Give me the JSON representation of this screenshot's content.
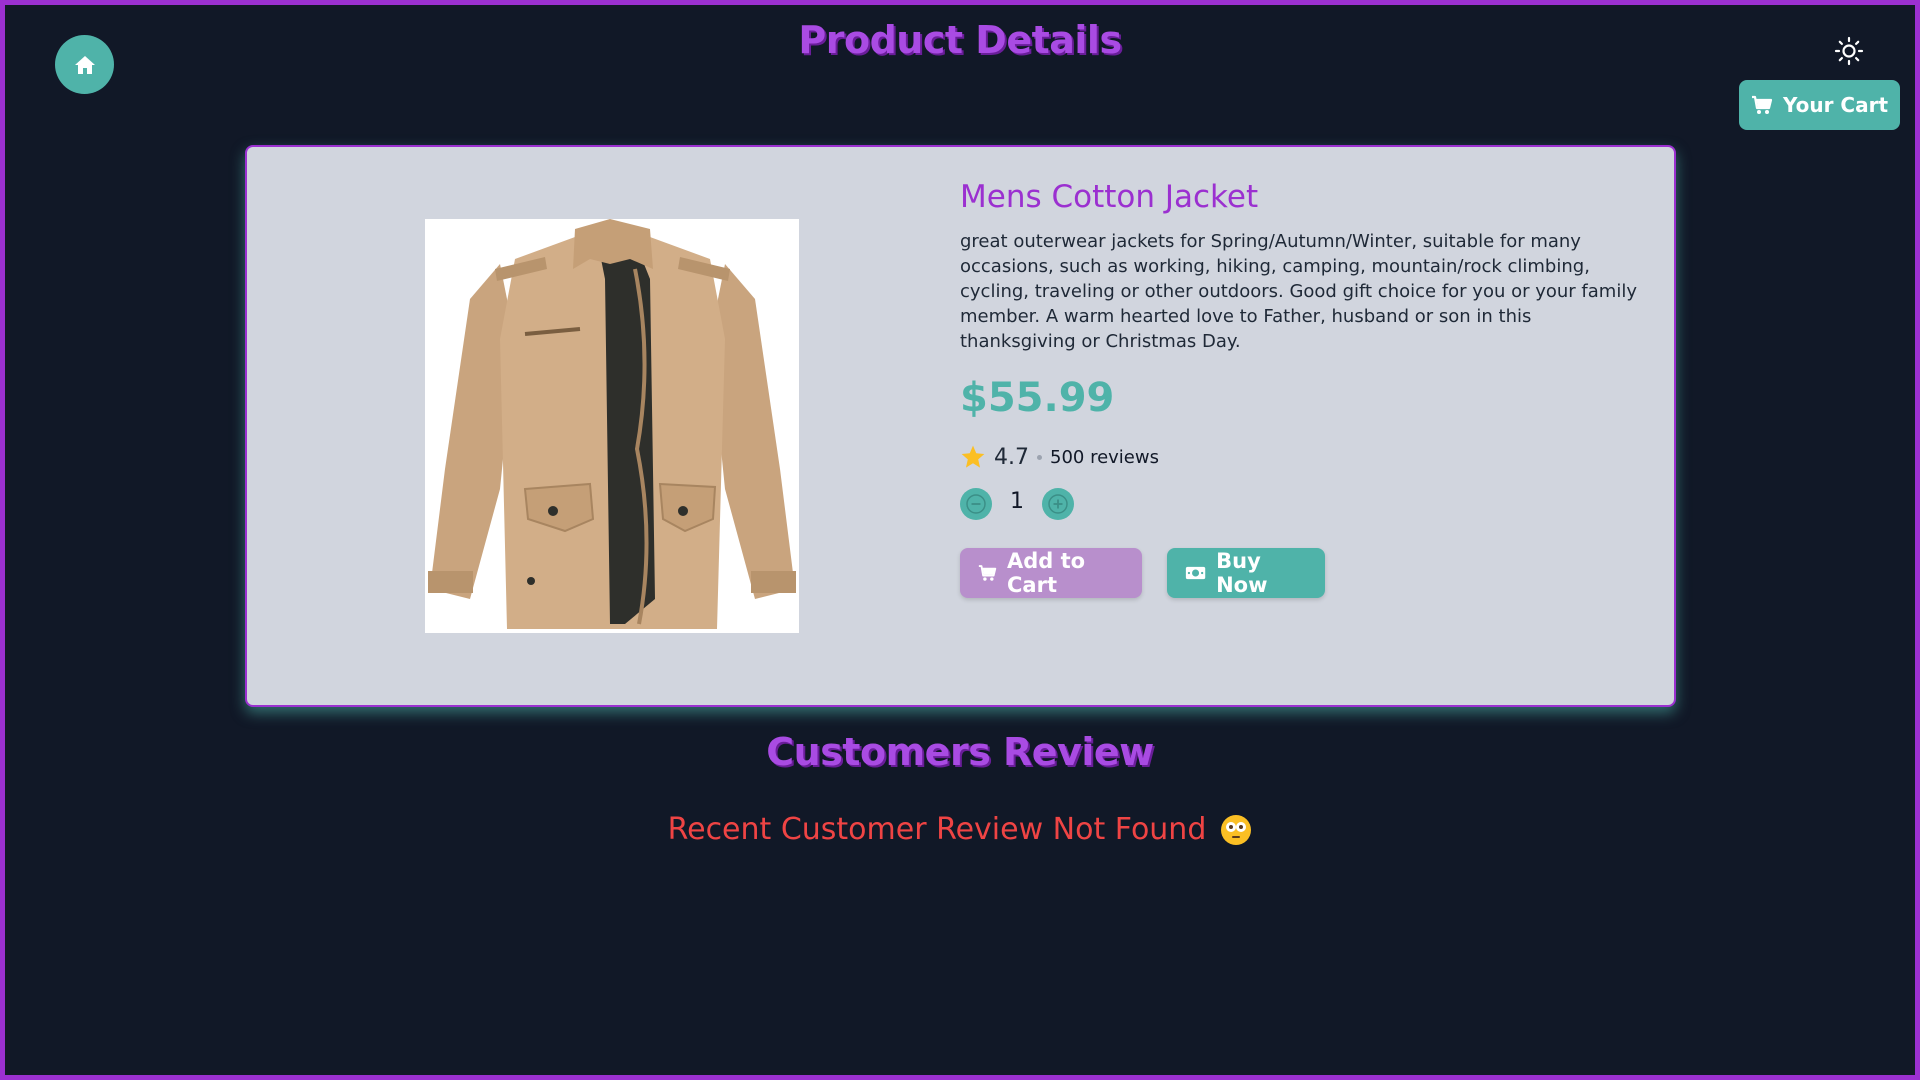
{
  "header": {
    "title": "Product Details",
    "cart_label": "Your Cart"
  },
  "product": {
    "name": "Mens Cotton Jacket",
    "description": "great outerwear jackets for Spring/Autumn/Winter, suitable for many occasions, such as working, hiking, camping, mountain/rock climbing, cycling, traveling or other outdoors. Good gift choice for you or your family member. A warm hearted love to Father, husband or son in this thanksgiving or Christmas Day.",
    "price": "$55.99",
    "rating": "4.7",
    "reviews": "500 reviews",
    "quantity": "1"
  },
  "actions": {
    "add_to_cart": "Add to Cart",
    "buy_now": "Buy Now"
  },
  "reviews_section": {
    "title": "Customers Review",
    "empty_message": "Recent Customer Review Not Found"
  },
  "colors": {
    "accent_teal": "#4fb3a9",
    "accent_purple": "#9b30d0",
    "background": "#111827",
    "error_red": "#ef4444"
  },
  "icons": [
    "home-icon",
    "sun-icon",
    "cart-icon",
    "star-icon",
    "minus-icon",
    "plus-icon",
    "money-icon",
    "flushed-face-icon"
  ]
}
